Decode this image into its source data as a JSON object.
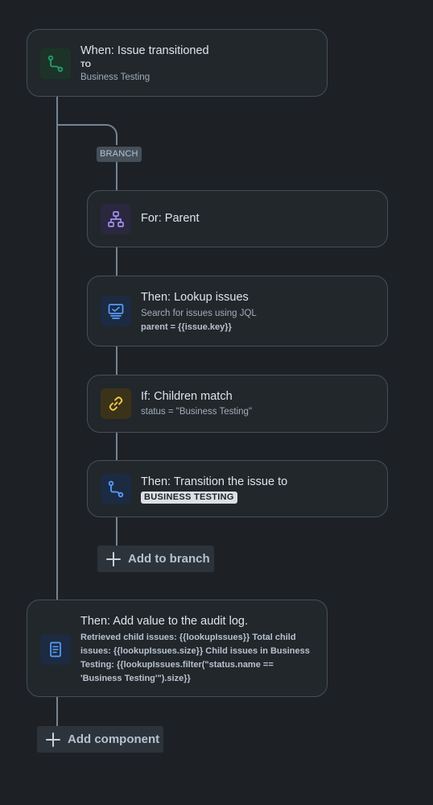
{
  "trigger": {
    "title": "When: Issue transitioned",
    "to_label": "TO",
    "to_value": "Business Testing",
    "icon": "transition-icon"
  },
  "branch": {
    "badge": "BRANCH",
    "for_card": {
      "title": "For: Parent",
      "icon": "hierarchy-icon"
    },
    "lookup_card": {
      "title": "Then: Lookup issues",
      "subtitle": "Search for issues using JQL",
      "query": "parent = {{issue.key}}",
      "icon": "monitor-icon"
    },
    "if_card": {
      "title": "If: Children match",
      "condition": "status = \"Business Testing\"",
      "icon": "link-icon"
    },
    "transition_card": {
      "title": "Then: Transition the issue to",
      "status": "BUSINESS TESTING",
      "icon": "transition-icon"
    },
    "add_label": "Add to branch"
  },
  "audit": {
    "title": "Then: Add value to the audit log.",
    "lines": [
      "Retrieved child issues: {{lookupIssues}} Total child",
      "issues: {{lookupIssues.size}} Child issues in Business",
      "Testing: {{lookupIssues.filter(\"status.name ==",
      "'Business Testing'\").size}}"
    ],
    "icon": "document-icon"
  },
  "add_component_label": "Add component",
  "colors": {
    "background": "#1d2125",
    "card": "#22272b",
    "border": "#454f59",
    "connector": "#738496",
    "green_icon": "#22a06b",
    "purple_icon": "#9f8fef",
    "blue_icon": "#579dff",
    "yellow_icon": "#f5cd47"
  }
}
